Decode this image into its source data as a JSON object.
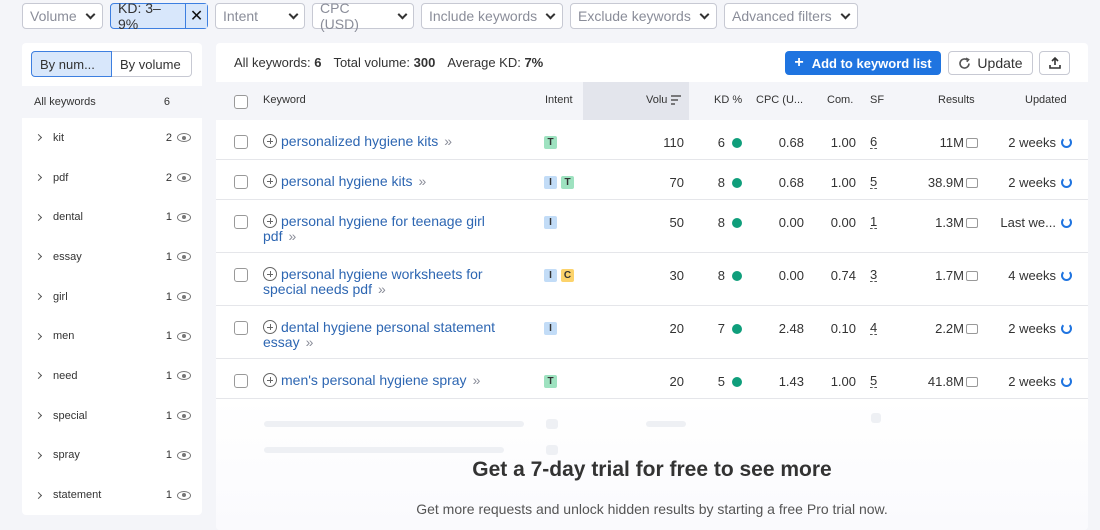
{
  "filters": {
    "volume": "Volume",
    "kd": "KD: 3–9%",
    "intent": "Intent",
    "cpc": "CPC (USD)",
    "include": "Include keywords",
    "exclude": "Exclude keywords",
    "advanced": "Advanced filters"
  },
  "sidebar": {
    "tab_by_number": "By num...",
    "tab_by_volume": "By volume",
    "header_label": "All keywords",
    "header_count": "6",
    "items": [
      {
        "label": "kit",
        "count": "2"
      },
      {
        "label": "pdf",
        "count": "2"
      },
      {
        "label": "dental",
        "count": "1"
      },
      {
        "label": "essay",
        "count": "1"
      },
      {
        "label": "girl",
        "count": "1"
      },
      {
        "label": "men",
        "count": "1"
      },
      {
        "label": "need",
        "count": "1"
      },
      {
        "label": "special",
        "count": "1"
      },
      {
        "label": "spray",
        "count": "1"
      },
      {
        "label": "statement",
        "count": "1"
      }
    ]
  },
  "summary": {
    "all_keywords_label": "All keywords:",
    "all_keywords_value": "6",
    "total_volume_label": "Total volume:",
    "total_volume_value": "300",
    "avg_kd_label": "Average KD:",
    "avg_kd_value": "7%"
  },
  "toolbar": {
    "add_label": "Add to keyword list",
    "update_label": "Update"
  },
  "table": {
    "headers": {
      "keyword": "Keyword",
      "intent": "Intent",
      "volume": "Volu",
      "kd": "KD %",
      "cpc": "CPC (U...",
      "com": "Com.",
      "sf": "SF",
      "results": "Results",
      "updated": "Updated"
    },
    "rows": [
      {
        "kw1": "personalized hygiene kits",
        "kw2": "",
        "intent": [
          "T"
        ],
        "volume": "110",
        "kd": "6",
        "cpc": "0.68",
        "com": "1.00",
        "sf": "6",
        "results": "11M",
        "updated": "2 weeks"
      },
      {
        "kw1": "personal hygiene kits",
        "kw2": "",
        "intent": [
          "I",
          "T"
        ],
        "volume": "70",
        "kd": "8",
        "cpc": "0.68",
        "com": "1.00",
        "sf": "5",
        "results": "38.9M",
        "updated": "2 weeks"
      },
      {
        "kw1": "personal hygiene for teenage girl pdf",
        "kw2": "",
        "intent": [
          "I"
        ],
        "volume": "50",
        "kd": "8",
        "cpc": "0.00",
        "com": "0.00",
        "sf": "1",
        "results": "1.3M",
        "updated": "Last we..."
      },
      {
        "kw1": "personal hygiene worksheets for",
        "kw2": "special needs pdf",
        "intent": [
          "I",
          "C"
        ],
        "volume": "30",
        "kd": "8",
        "cpc": "0.00",
        "com": "0.74",
        "sf": "3",
        "results": "1.7M",
        "updated": "4 weeks"
      },
      {
        "kw1": "dental hygiene personal statement",
        "kw2": "essay",
        "intent": [
          "I"
        ],
        "volume": "20",
        "kd": "7",
        "cpc": "2.48",
        "com": "0.10",
        "sf": "4",
        "results": "2.2M",
        "updated": "2 weeks"
      },
      {
        "kw1": "men's personal hygiene spray",
        "kw2": "",
        "intent": [
          "T"
        ],
        "volume": "20",
        "kd": "5",
        "cpc": "1.43",
        "com": "1.00",
        "sf": "5",
        "results": "41.8M",
        "updated": "2 weeks"
      }
    ]
  },
  "trial": {
    "title": "Get a 7-day trial for free to see more",
    "subtitle": "Get more requests and unlock hidden results by starting a free Pro trial now."
  },
  "colors": {
    "accent": "#1f74e0",
    "kd_dot": "#0f9e7b",
    "intent_T": "#9ee2c0",
    "intent_I": "#c2dcf7",
    "intent_C": "#fcd36b"
  }
}
